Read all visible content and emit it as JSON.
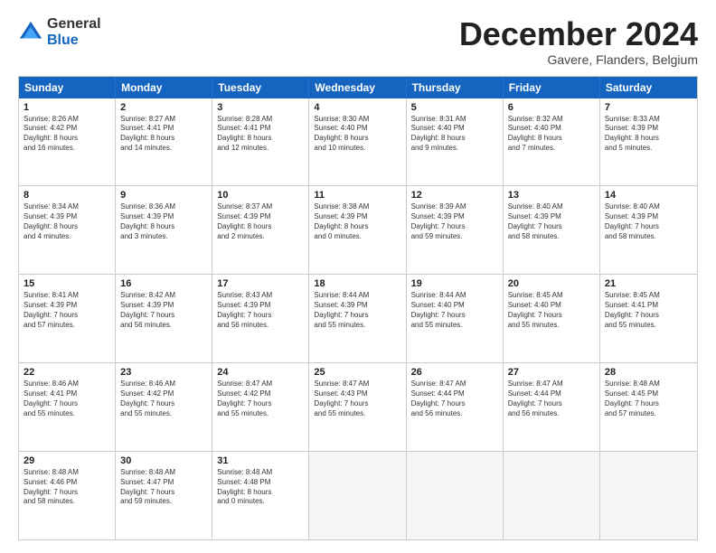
{
  "logo": {
    "general": "General",
    "blue": "Blue"
  },
  "title": "December 2024",
  "subtitle": "Gavere, Flanders, Belgium",
  "header_days": [
    "Sunday",
    "Monday",
    "Tuesday",
    "Wednesday",
    "Thursday",
    "Friday",
    "Saturday"
  ],
  "rows": [
    [
      {
        "day": "1",
        "text": "Sunrise: 8:26 AM\nSunset: 4:42 PM\nDaylight: 8 hours\nand 16 minutes."
      },
      {
        "day": "2",
        "text": "Sunrise: 8:27 AM\nSunset: 4:41 PM\nDaylight: 8 hours\nand 14 minutes."
      },
      {
        "day": "3",
        "text": "Sunrise: 8:28 AM\nSunset: 4:41 PM\nDaylight: 8 hours\nand 12 minutes."
      },
      {
        "day": "4",
        "text": "Sunrise: 8:30 AM\nSunset: 4:40 PM\nDaylight: 8 hours\nand 10 minutes."
      },
      {
        "day": "5",
        "text": "Sunrise: 8:31 AM\nSunset: 4:40 PM\nDaylight: 8 hours\nand 9 minutes."
      },
      {
        "day": "6",
        "text": "Sunrise: 8:32 AM\nSunset: 4:40 PM\nDaylight: 8 hours\nand 7 minutes."
      },
      {
        "day": "7",
        "text": "Sunrise: 8:33 AM\nSunset: 4:39 PM\nDaylight: 8 hours\nand 5 minutes."
      }
    ],
    [
      {
        "day": "8",
        "text": "Sunrise: 8:34 AM\nSunset: 4:39 PM\nDaylight: 8 hours\nand 4 minutes."
      },
      {
        "day": "9",
        "text": "Sunrise: 8:36 AM\nSunset: 4:39 PM\nDaylight: 8 hours\nand 3 minutes."
      },
      {
        "day": "10",
        "text": "Sunrise: 8:37 AM\nSunset: 4:39 PM\nDaylight: 8 hours\nand 2 minutes."
      },
      {
        "day": "11",
        "text": "Sunrise: 8:38 AM\nSunset: 4:39 PM\nDaylight: 8 hours\nand 0 minutes."
      },
      {
        "day": "12",
        "text": "Sunrise: 8:39 AM\nSunset: 4:39 PM\nDaylight: 7 hours\nand 59 minutes."
      },
      {
        "day": "13",
        "text": "Sunrise: 8:40 AM\nSunset: 4:39 PM\nDaylight: 7 hours\nand 58 minutes."
      },
      {
        "day": "14",
        "text": "Sunrise: 8:40 AM\nSunset: 4:39 PM\nDaylight: 7 hours\nand 58 minutes."
      }
    ],
    [
      {
        "day": "15",
        "text": "Sunrise: 8:41 AM\nSunset: 4:39 PM\nDaylight: 7 hours\nand 57 minutes."
      },
      {
        "day": "16",
        "text": "Sunrise: 8:42 AM\nSunset: 4:39 PM\nDaylight: 7 hours\nand 56 minutes."
      },
      {
        "day": "17",
        "text": "Sunrise: 8:43 AM\nSunset: 4:39 PM\nDaylight: 7 hours\nand 56 minutes."
      },
      {
        "day": "18",
        "text": "Sunrise: 8:44 AM\nSunset: 4:39 PM\nDaylight: 7 hours\nand 55 minutes."
      },
      {
        "day": "19",
        "text": "Sunrise: 8:44 AM\nSunset: 4:40 PM\nDaylight: 7 hours\nand 55 minutes."
      },
      {
        "day": "20",
        "text": "Sunrise: 8:45 AM\nSunset: 4:40 PM\nDaylight: 7 hours\nand 55 minutes."
      },
      {
        "day": "21",
        "text": "Sunrise: 8:45 AM\nSunset: 4:41 PM\nDaylight: 7 hours\nand 55 minutes."
      }
    ],
    [
      {
        "day": "22",
        "text": "Sunrise: 8:46 AM\nSunset: 4:41 PM\nDaylight: 7 hours\nand 55 minutes."
      },
      {
        "day": "23",
        "text": "Sunrise: 8:46 AM\nSunset: 4:42 PM\nDaylight: 7 hours\nand 55 minutes."
      },
      {
        "day": "24",
        "text": "Sunrise: 8:47 AM\nSunset: 4:42 PM\nDaylight: 7 hours\nand 55 minutes."
      },
      {
        "day": "25",
        "text": "Sunrise: 8:47 AM\nSunset: 4:43 PM\nDaylight: 7 hours\nand 55 minutes."
      },
      {
        "day": "26",
        "text": "Sunrise: 8:47 AM\nSunset: 4:44 PM\nDaylight: 7 hours\nand 56 minutes."
      },
      {
        "day": "27",
        "text": "Sunrise: 8:47 AM\nSunset: 4:44 PM\nDaylight: 7 hours\nand 56 minutes."
      },
      {
        "day": "28",
        "text": "Sunrise: 8:48 AM\nSunset: 4:45 PM\nDaylight: 7 hours\nand 57 minutes."
      }
    ],
    [
      {
        "day": "29",
        "text": "Sunrise: 8:48 AM\nSunset: 4:46 PM\nDaylight: 7 hours\nand 58 minutes."
      },
      {
        "day": "30",
        "text": "Sunrise: 8:48 AM\nSunset: 4:47 PM\nDaylight: 7 hours\nand 59 minutes."
      },
      {
        "day": "31",
        "text": "Sunrise: 8:48 AM\nSunset: 4:48 PM\nDaylight: 8 hours\nand 0 minutes."
      },
      {
        "day": "",
        "text": ""
      },
      {
        "day": "",
        "text": ""
      },
      {
        "day": "",
        "text": ""
      },
      {
        "day": "",
        "text": ""
      }
    ]
  ]
}
